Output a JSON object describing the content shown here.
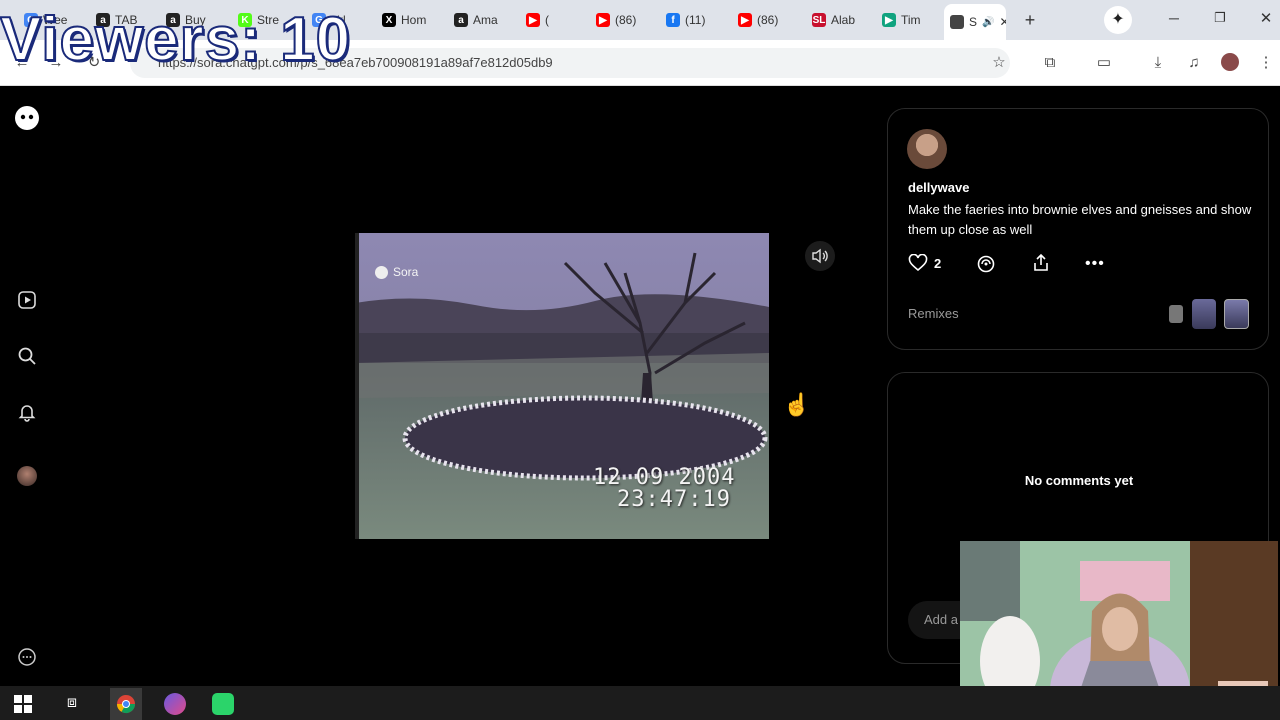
{
  "overlay": {
    "viewers": "Viewers: 10"
  },
  "tabs": [
    {
      "label": "Wee",
      "color": "#4285f4",
      "glyph": "G"
    },
    {
      "label": "TAB",
      "color": "#222",
      "glyph": "a"
    },
    {
      "label": "Buy",
      "color": "#222",
      "glyph": "a"
    },
    {
      "label": "Stre",
      "color": "#53fc18",
      "glyph": "K"
    },
    {
      "label": "ckl",
      "color": "#4285f4",
      "glyph": "G"
    },
    {
      "label": "Hom",
      "color": "#000",
      "glyph": "X"
    },
    {
      "label": "Ama",
      "color": "#222",
      "glyph": "a"
    },
    {
      "label": "(",
      "color": "#ff0000",
      "glyph": "▶"
    },
    {
      "label": "(86)",
      "color": "#ff0000",
      "glyph": "▶"
    },
    {
      "label": "(11)",
      "color": "#1877f2",
      "glyph": "f"
    },
    {
      "label": "(86)",
      "color": "#ff0000",
      "glyph": "▶"
    },
    {
      "label": "Alab",
      "color": "#c8102e",
      "glyph": "SL"
    },
    {
      "label": "Tim",
      "color": "#10a37f",
      "glyph": "▶"
    },
    {
      "label": "S",
      "color": "#444",
      "glyph": ""
    }
  ],
  "browser": {
    "url": "https://sora.chatgpt.com/p/s_68ea7eb700908191a89af7e812d05db9"
  },
  "video": {
    "watermark": "Sora",
    "date": "12 09 2004",
    "time": "23:47:19"
  },
  "post": {
    "username": "dellywave",
    "prompt": "Make the faeries into brownie elves and gneisses and show them up close as well",
    "likes": "2",
    "remixes_label": "Remixes"
  },
  "comments": {
    "empty_text": "No comments yet",
    "input_placeholder": "Add a"
  },
  "colors": {
    "accent": "#ffffff",
    "panel_border": "#2a2a2a",
    "muted_text": "#9a9a9a"
  }
}
